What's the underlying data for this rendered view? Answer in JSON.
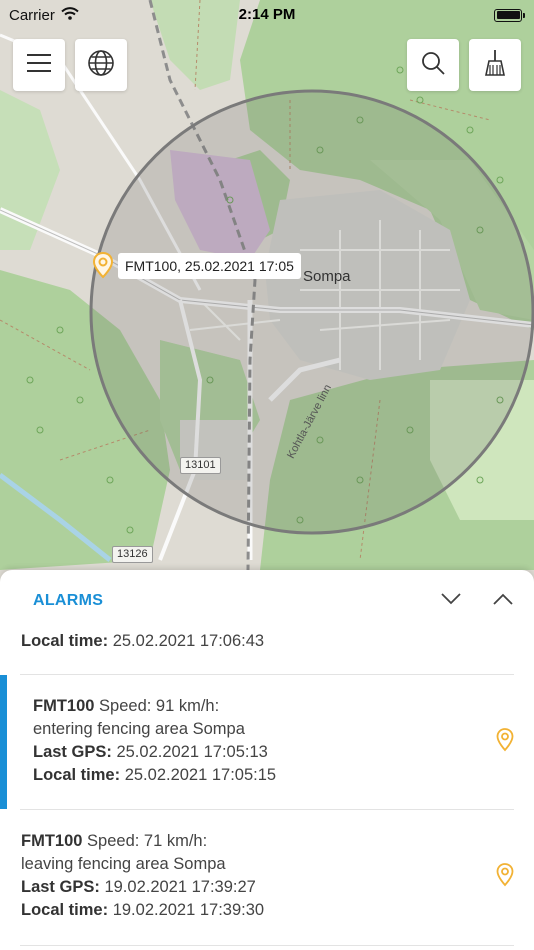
{
  "status_bar": {
    "carrier": "Carrier",
    "time": "2:14 PM"
  },
  "toolbar": {
    "menu_icon": "hamburger-menu-icon",
    "globe_icon": "globe-icon",
    "search_icon": "search-icon",
    "clear_icon": "broom-icon"
  },
  "map": {
    "marker_label": "FMT100, 25.02.2021 17:05",
    "place_label": "Sompa",
    "street_label": "Kohtla-Järve linn",
    "road_labels": [
      "13101",
      "13126"
    ],
    "colors": {
      "forest": "#a9cf98",
      "residential": "#dcdcd6",
      "fence_circle": "#7a7a7a",
      "marker": "#f2b234"
    }
  },
  "panel": {
    "title": "ALARMS",
    "partial_item": {
      "local_time_label": "Local time:",
      "local_time": "25.02.2021 17:06:43"
    },
    "items": [
      {
        "device": "FMT100",
        "speed_text": "Speed: 91 km/h:",
        "event": "entering fencing area Sompa",
        "last_gps_label": "Last GPS:",
        "last_gps": "25.02.2021 17:05:13",
        "local_time_label": "Local time:",
        "local_time": "25.02.2021 17:05:15",
        "selected": true
      },
      {
        "device": "FMT100",
        "speed_text": "Speed: 71 km/h:",
        "event": "leaving fencing area Sompa",
        "last_gps_label": "Last GPS:",
        "last_gps": "19.02.2021 17:39:27",
        "local_time_label": "Local time:",
        "local_time": "19.02.2021 17:39:30",
        "selected": false
      }
    ],
    "accent_color": "#1a8fd6"
  }
}
